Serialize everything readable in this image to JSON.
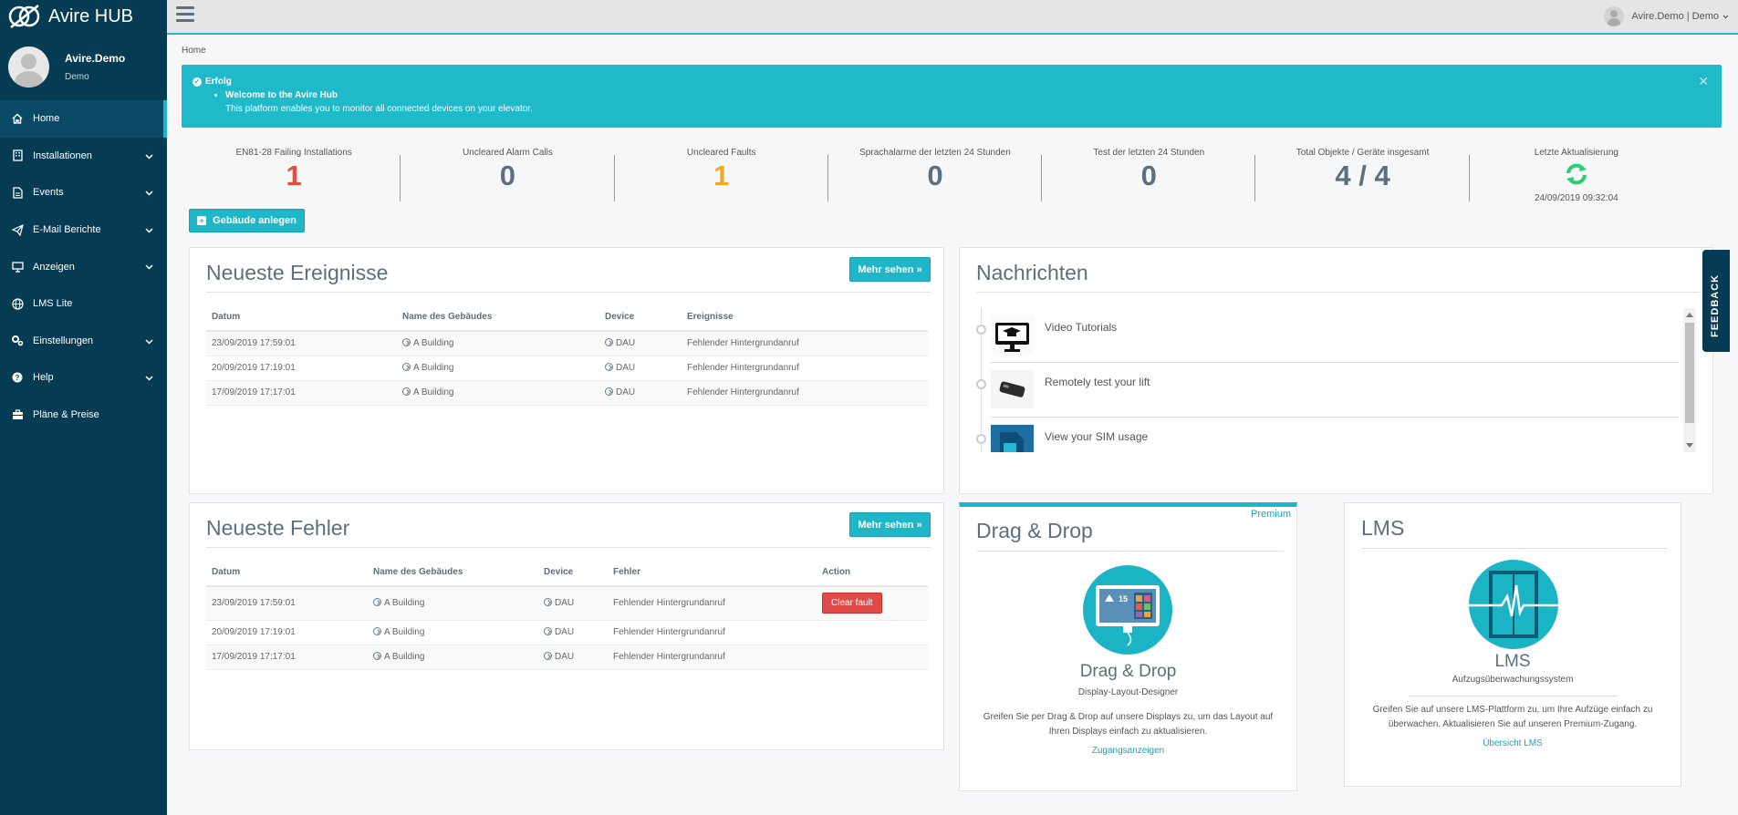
{
  "app": {
    "title": "Avire HUB"
  },
  "profile": {
    "name": "Avire.Demo",
    "role": "Demo"
  },
  "sidebar": {
    "items": [
      {
        "label": "Home"
      },
      {
        "label": "Installationen"
      },
      {
        "label": "Events"
      },
      {
        "label": "E-Mail Berichte"
      },
      {
        "label": "Anzeigen"
      },
      {
        "label": "LMS Lite"
      },
      {
        "label": "Einstellungen"
      },
      {
        "label": "Help"
      },
      {
        "label": "Pläne & Preise"
      }
    ]
  },
  "topbar": {
    "user": "Avire.Demo | Demo"
  },
  "breadcrumb": "Home",
  "alert": {
    "title": "Erfolg",
    "item": "Welcome to the Avire Hub",
    "text": "This platform enables you to monitor all connected devices on your elevator."
  },
  "stats": [
    {
      "label": "EN81-28 Failing Installations",
      "value": "1"
    },
    {
      "label": "Uncleared Alarm Calls",
      "value": "0"
    },
    {
      "label": "Uncleared Faults",
      "value": "1"
    },
    {
      "label": "Sprachalarme der letzten 24 Stunden",
      "value": "0"
    },
    {
      "label": "Test der letzten 24 Stunden",
      "value": "0"
    },
    {
      "label": "Total Objekte / Geräte insgesamt",
      "value": "4 / 4"
    },
    {
      "label": "Letzte Aktualisierung",
      "date": "24/09/2019 09:32:04"
    }
  ],
  "create_button": "Gebäude anlegen",
  "events": {
    "title": "Neueste Ereignisse",
    "more": "Mehr sehen »",
    "headers": [
      "Datum",
      "Name des Gebäudes",
      "Device",
      "Ereignisse"
    ],
    "rows": [
      {
        "date": "23/09/2019 17:59:01",
        "building": "A Building",
        "device": "DAU",
        "event": "Fehlender Hintergrundanruf"
      },
      {
        "date": "20/09/2019 17:19:01",
        "building": "A Building",
        "device": "DAU",
        "event": "Fehlender Hintergrundanruf"
      },
      {
        "date": "17/09/2019 17:17:01",
        "building": "A Building",
        "device": "DAU",
        "event": "Fehlender Hintergrundanruf"
      }
    ]
  },
  "news": {
    "title": "Nachrichten",
    "items": [
      {
        "label": "Video Tutorials"
      },
      {
        "label": "Remotely test your lift"
      },
      {
        "label": "View your SIM usage"
      }
    ]
  },
  "faults": {
    "title": "Neueste Fehler",
    "more": "Mehr sehen »",
    "headers": [
      "Datum",
      "Name des Gebäudes",
      "Device",
      "Fehler",
      "Action"
    ],
    "clear_label": "Clear fault",
    "rows": [
      {
        "date": "23/09/2019 17:59:01",
        "building": "A Building",
        "device": "DAU",
        "fault": "Fehlender Hintergrundanruf"
      },
      {
        "date": "20/09/2019 17:19:01",
        "building": "A Building",
        "device": "DAU",
        "fault": "Fehlender Hintergrundanruf"
      },
      {
        "date": "17/09/2019 17:17:01",
        "building": "A Building",
        "device": "DAU",
        "fault": "Fehlender Hintergrundanruf"
      }
    ]
  },
  "dragdrop": {
    "title": "Drag & Drop",
    "badge": "Premium",
    "name": "Drag & Drop",
    "sub": "Display-Layout-Designer",
    "desc": "Greifen Sie per Drag & Drop auf unsere Displays zu, um das Layout auf Ihren Displays einfach zu aktualisieren.",
    "link": "Zugangsanzeigen",
    "screen_number": "15"
  },
  "lms": {
    "title": "LMS",
    "name": "LMS",
    "sub": "Aufzugsüberwachungssystem",
    "desc": "Greifen Sie auf unsere LMS-Plattform zu, um Ihre Aufzüge einfach zu überwachen. Aktualisieren Sie auf unseren Premium-Zugang.",
    "link": "Übersicht LMS"
  },
  "feedback": "FEEDBACK",
  "colors": {
    "sidebar": "#053c54",
    "accent": "#1fb6c8",
    "danger": "#e74c3c",
    "warning": "#f5a623",
    "success": "#2ecc71"
  }
}
